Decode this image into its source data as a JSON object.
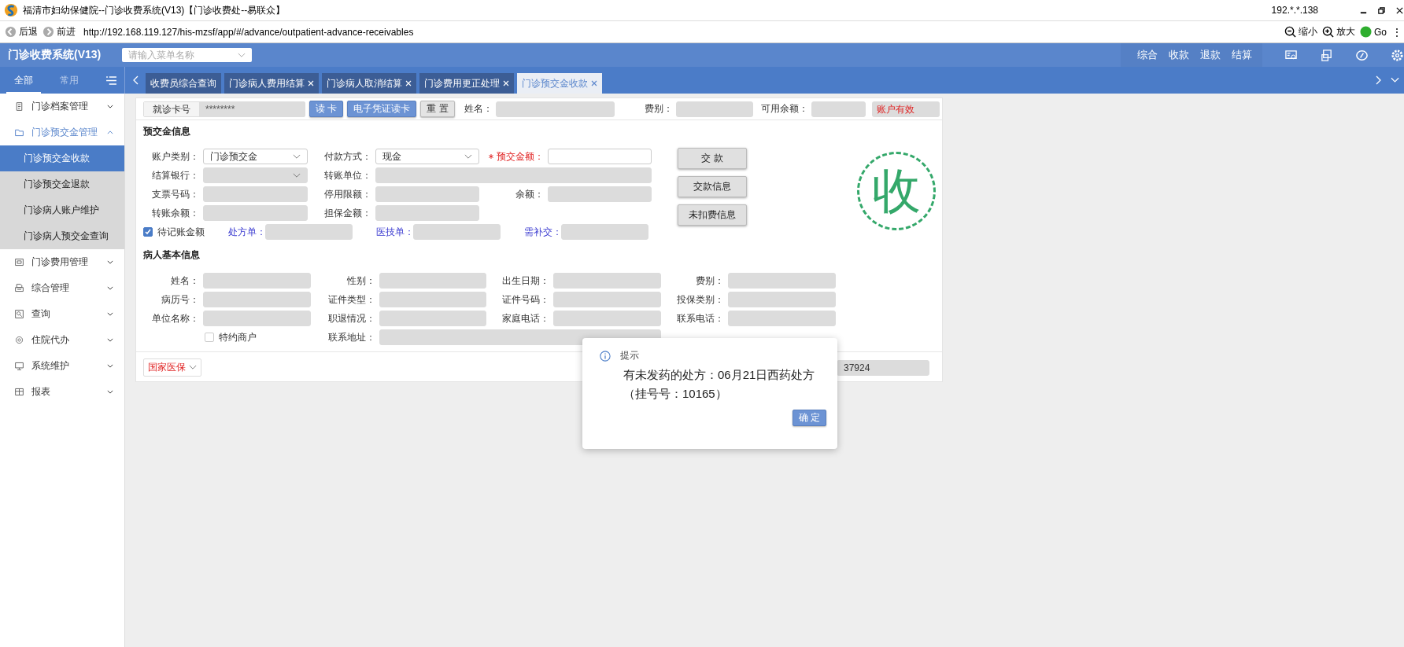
{
  "window": {
    "title": "福清市妇幼保健院--门诊收费系统(V13)【门诊收费处--易联众】",
    "ip": "192.*.*.138"
  },
  "browser": {
    "back": "后退",
    "forward": "前进",
    "url": "http://192.168.119.127/his-mzsf/app/#/advance/outpatient-advance-receivables",
    "zoom_out": "缩小",
    "zoom_in": "放大",
    "go": "Go",
    "more": "⋮"
  },
  "header": {
    "title": "门诊收费系统(V13)",
    "menu_search": {
      "placeholder": "请输入菜单名称"
    },
    "actions": [
      "综合",
      "收款",
      "退款",
      "结算"
    ]
  },
  "sidebar": {
    "tabs": [
      {
        "label": "全部",
        "selected": true
      },
      {
        "label": "常用",
        "selected": false
      }
    ],
    "items": [
      {
        "label": "门诊档案管理",
        "expanded": false
      },
      {
        "label": "门诊预交金管理",
        "expanded": true,
        "children": [
          {
            "label": "门诊预交金收款",
            "selected": true
          },
          {
            "label": "门诊预交金退款",
            "selected": false
          },
          {
            "label": "门诊病人账户维护",
            "selected": false
          },
          {
            "label": "门诊病人预交金查询",
            "selected": false
          }
        ]
      },
      {
        "label": "门诊费用管理",
        "expanded": false
      },
      {
        "label": "综合管理",
        "expanded": false
      },
      {
        "label": "查询",
        "expanded": false
      },
      {
        "label": "住院代办",
        "expanded": false
      },
      {
        "label": "系统维护",
        "expanded": false
      },
      {
        "label": "报表",
        "expanded": false
      }
    ]
  },
  "tabs": [
    {
      "label": "收费员综合查询",
      "closable": false,
      "selected": false
    },
    {
      "label": "门诊病人费用结算",
      "closable": true,
      "selected": false
    },
    {
      "label": "门诊病人取消结算",
      "closable": true,
      "selected": false
    },
    {
      "label": "门诊费用更正处理",
      "closable": true,
      "selected": false
    },
    {
      "label": "门诊预交金收款",
      "closable": true,
      "selected": true
    }
  ],
  "card_bar": {
    "card": {
      "label": "就诊卡号",
      "value": "********"
    },
    "buttons": [
      {
        "label": "读 卡",
        "kind": "primary"
      },
      {
        "label": "电子凭证读卡",
        "kind": "primary"
      },
      {
        "label": "重 置",
        "kind": "default"
      }
    ],
    "fields": [
      {
        "label": "姓名："
      },
      {
        "label": "费别："
      },
      {
        "label": "可用余额："
      }
    ],
    "status": "账户有效"
  },
  "prepay": {
    "title": "预交金信息",
    "fields": [
      {
        "label": "账户类别：",
        "kind": "select",
        "value": "门诊预交金",
        "disabled": false,
        "required": false
      },
      {
        "label": "付款方式：",
        "kind": "select",
        "value": "现金",
        "disabled": false,
        "required": false
      },
      {
        "label": "预交金额：",
        "kind": "input",
        "disabled": false,
        "required": true
      },
      {
        "label": "结算银行：",
        "kind": "select",
        "disabled": true,
        "required": false
      },
      {
        "label": "转账单位：",
        "kind": "input",
        "disabled": true,
        "required": false
      },
      {
        "label": "支票号码：",
        "kind": "input",
        "disabled": true,
        "required": false
      },
      {
        "label": "停用限额：",
        "kind": "input",
        "disabled": true,
        "required": false
      },
      {
        "label": "余额：",
        "kind": "input",
        "disabled": true,
        "required": false
      },
      {
        "label": "转账余额：",
        "kind": "input",
        "disabled": true,
        "required": false
      },
      {
        "label": "担保金额：",
        "kind": "input",
        "disabled": true,
        "required": false
      }
    ],
    "pending": {
      "label": "待记账金额",
      "checked": true
    },
    "links": [
      {
        "label": "处方单："
      },
      {
        "label": "医技单："
      },
      {
        "label": "需补交："
      }
    ],
    "buttons": [
      "交 款",
      "交款信息",
      "未扣费信息"
    ],
    "stamp": "收"
  },
  "patient": {
    "title": "病人基本信息",
    "fields": [
      {
        "label": "姓名：",
        "kind": "input"
      },
      {
        "label": "性别：",
        "kind": "input"
      },
      {
        "label": "出生日期：",
        "kind": "input"
      },
      {
        "label": "费别：",
        "kind": "input"
      },
      {
        "label": "病历号：",
        "kind": "input"
      },
      {
        "label": "证件类型：",
        "kind": "input"
      },
      {
        "label": "证件号码：",
        "kind": "input"
      },
      {
        "label": "投保类别：",
        "kind": "input"
      },
      {
        "label": "单位名称：",
        "kind": "input"
      },
      {
        "label": "职退情况：",
        "kind": "input"
      },
      {
        "label": "家庭电话：",
        "kind": "input"
      },
      {
        "label": "联系电话：",
        "kind": "input"
      },
      {
        "label": "特约商户",
        "kind": "checkbox",
        "checked": false
      },
      {
        "label": "联系地址：",
        "kind": "input"
      }
    ]
  },
  "bottom_bar": {
    "insurance": "国家医保",
    "field_value": "37924"
  },
  "dialog": {
    "title": "提示",
    "message": "有未发药的处方：06月21日西药处方（挂号号：10165）",
    "button": "确 定"
  }
}
